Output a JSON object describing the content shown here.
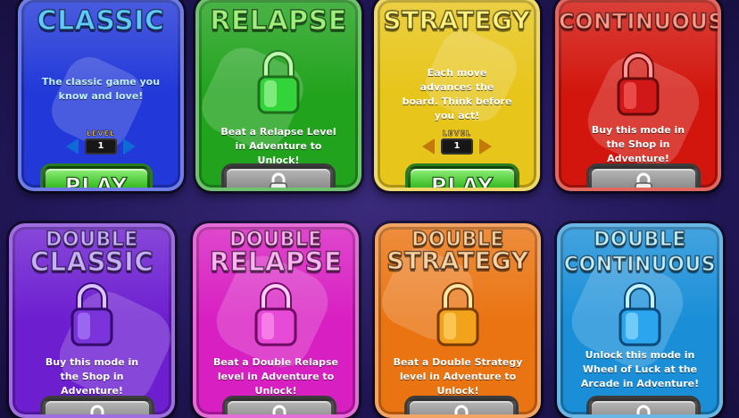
{
  "modes": [
    {
      "id": "classic",
      "title": "CLASSIC",
      "desc": "The classic game you know and love!",
      "level_label": "LEVEL",
      "level_value": "1",
      "button": "PLAY",
      "locked": false,
      "colors": {
        "bg": "#2238d8",
        "title": "#5ecbff",
        "lock": "#3b5ed8"
      }
    },
    {
      "id": "relapse",
      "title": "RELAPSE",
      "desc": "Beat a Relapse Level in Adventure to Unlock!",
      "locked": true,
      "colors": {
        "bg": "#22a31e",
        "title": "#9df07a",
        "lock": "#33d33a"
      }
    },
    {
      "id": "strategy",
      "title": "STRATEGY",
      "desc": "Each move advances the board. Think before you act!",
      "level_label": "LEVEL",
      "level_value": "1",
      "button": "PLAY",
      "locked": false,
      "colors": {
        "bg": "#e7c51a",
        "title": "#fff27a",
        "lock": "#e7c51a"
      }
    },
    {
      "id": "continuous",
      "title": "CONTINUOUS",
      "desc": "Buy this mode in the Shop in Adventure!",
      "locked": true,
      "colors": {
        "bg": "#d2160d",
        "title": "#ff9a8a",
        "lock": "#d01818"
      }
    },
    {
      "id": "double-classic",
      "title_top": "DOUBLE",
      "title": "CLASSIC",
      "desc": "Buy this mode in the Shop in Adventure!",
      "locked": true,
      "colors": {
        "bg": "#6d1fd0",
        "title": "#c9b0ff",
        "lock": "#7a34d9"
      }
    },
    {
      "id": "double-relapse",
      "title_top": "DOUBLE",
      "title": "RELAPSE",
      "desc": "Beat a Double Relapse level in Adventure to Unlock!",
      "locked": true,
      "colors": {
        "bg": "#d81fc2",
        "title": "#ffb3f2",
        "lock": "#e84ad8"
      }
    },
    {
      "id": "double-strategy",
      "title_top": "DOUBLE",
      "title": "STRATEGY",
      "desc": "Beat a Double Strategy level in Adventure to Unlock!",
      "locked": true,
      "colors": {
        "bg": "#ea7412",
        "title": "#ffd2a0",
        "lock": "#f3a21c"
      }
    },
    {
      "id": "double-continuous",
      "title_top": "DOUBLE",
      "title": "CONTINUOUS",
      "desc": "Unlock this mode in Wheel of Luck at the Arcade in Adventure!",
      "locked": true,
      "colors": {
        "bg": "#1a8fd8",
        "title": "#bff0ff",
        "lock": "#2aa5ee"
      }
    }
  ]
}
